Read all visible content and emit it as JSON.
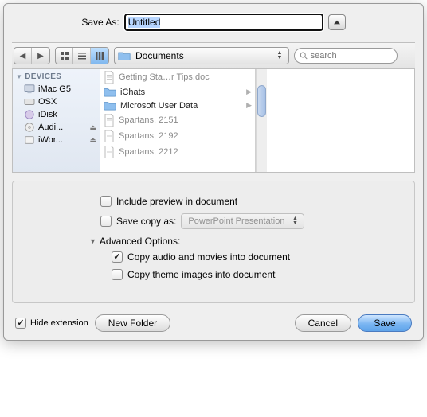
{
  "saveAs": {
    "label": "Save As:",
    "value": "Untitled"
  },
  "toolbar": {
    "path": "Documents",
    "searchPlaceholder": "search"
  },
  "sidebar": {
    "header": "DEVICES",
    "items": [
      {
        "label": "iMac G5",
        "kind": "computer"
      },
      {
        "label": "OSX",
        "kind": "hdd"
      },
      {
        "label": "iDisk",
        "kind": "idisk"
      },
      {
        "label": "Audi...",
        "kind": "cd",
        "eject": true
      },
      {
        "label": "iWor...",
        "kind": "dmg",
        "eject": true
      }
    ]
  },
  "column": [
    {
      "label": "Getting Sta…r Tips.doc",
      "kind": "doc"
    },
    {
      "label": "iChats",
      "kind": "folder"
    },
    {
      "label": "Microsoft User Data",
      "kind": "folder"
    },
    {
      "label": "Spartans, 2151",
      "kind": "doc"
    },
    {
      "label": "Spartans, 2192",
      "kind": "doc"
    },
    {
      "label": "Spartans, 2212",
      "kind": "doc"
    }
  ],
  "options": {
    "includePreview": {
      "label": "Include preview in document",
      "checked": false
    },
    "saveCopy": {
      "label": "Save copy as:",
      "checked": false,
      "format": "PowerPoint Presentation"
    },
    "advanced": {
      "header": "Advanced Options:",
      "copyMedia": {
        "label": "Copy audio and movies into document",
        "checked": true
      },
      "copyTheme": {
        "label": "Copy theme images into document",
        "checked": false
      }
    }
  },
  "bottom": {
    "hideExt": {
      "label": "Hide extension",
      "checked": true
    },
    "newFolder": "New Folder",
    "cancel": "Cancel",
    "save": "Save"
  }
}
